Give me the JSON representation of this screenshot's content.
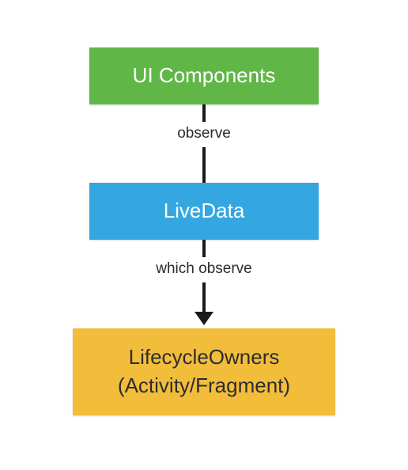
{
  "nodes": {
    "ui_components": "UI Components",
    "livedata": "LiveData",
    "lifecycle_owners": "LifecycleOwners\n(Activity/Fragment)"
  },
  "edges": {
    "observe": "observe",
    "which_observe": "which observe"
  },
  "colors": {
    "green": "#61b648",
    "blue": "#34a7e0",
    "yellow": "#f2bd3b",
    "arrow": "#1a1a1a"
  }
}
